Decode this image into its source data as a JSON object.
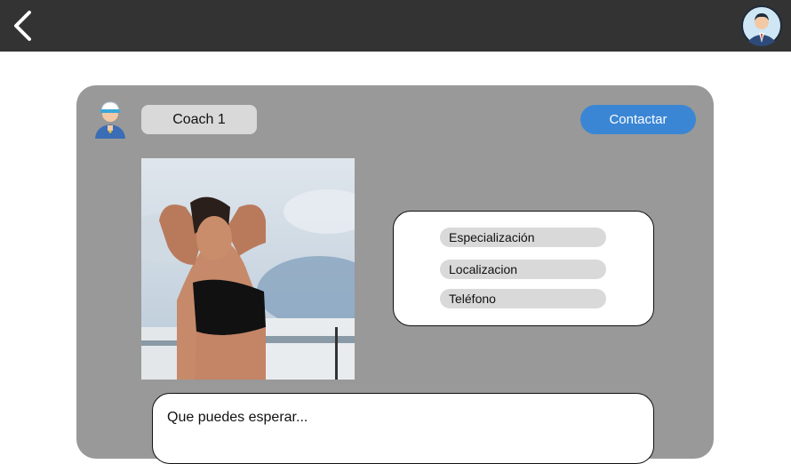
{
  "header": {
    "back_icon": "chevron-left-icon",
    "user_avatar_icon": "businessman-avatar-icon"
  },
  "coach": {
    "avatar_icon": "coach-avatar-icon",
    "name": "Coach 1",
    "contact_label": "Contactar",
    "photo_alt": "coach-photo"
  },
  "info": {
    "items": [
      {
        "label": "Especialización"
      },
      {
        "label": "Localizacion"
      },
      {
        "label": "Teléfono"
      }
    ]
  },
  "expect": {
    "title": "Que puedes esperar..."
  },
  "colors": {
    "topbar": "#333333",
    "card": "#999999",
    "pill": "#d9d9d9",
    "accent": "#3a86d4"
  }
}
